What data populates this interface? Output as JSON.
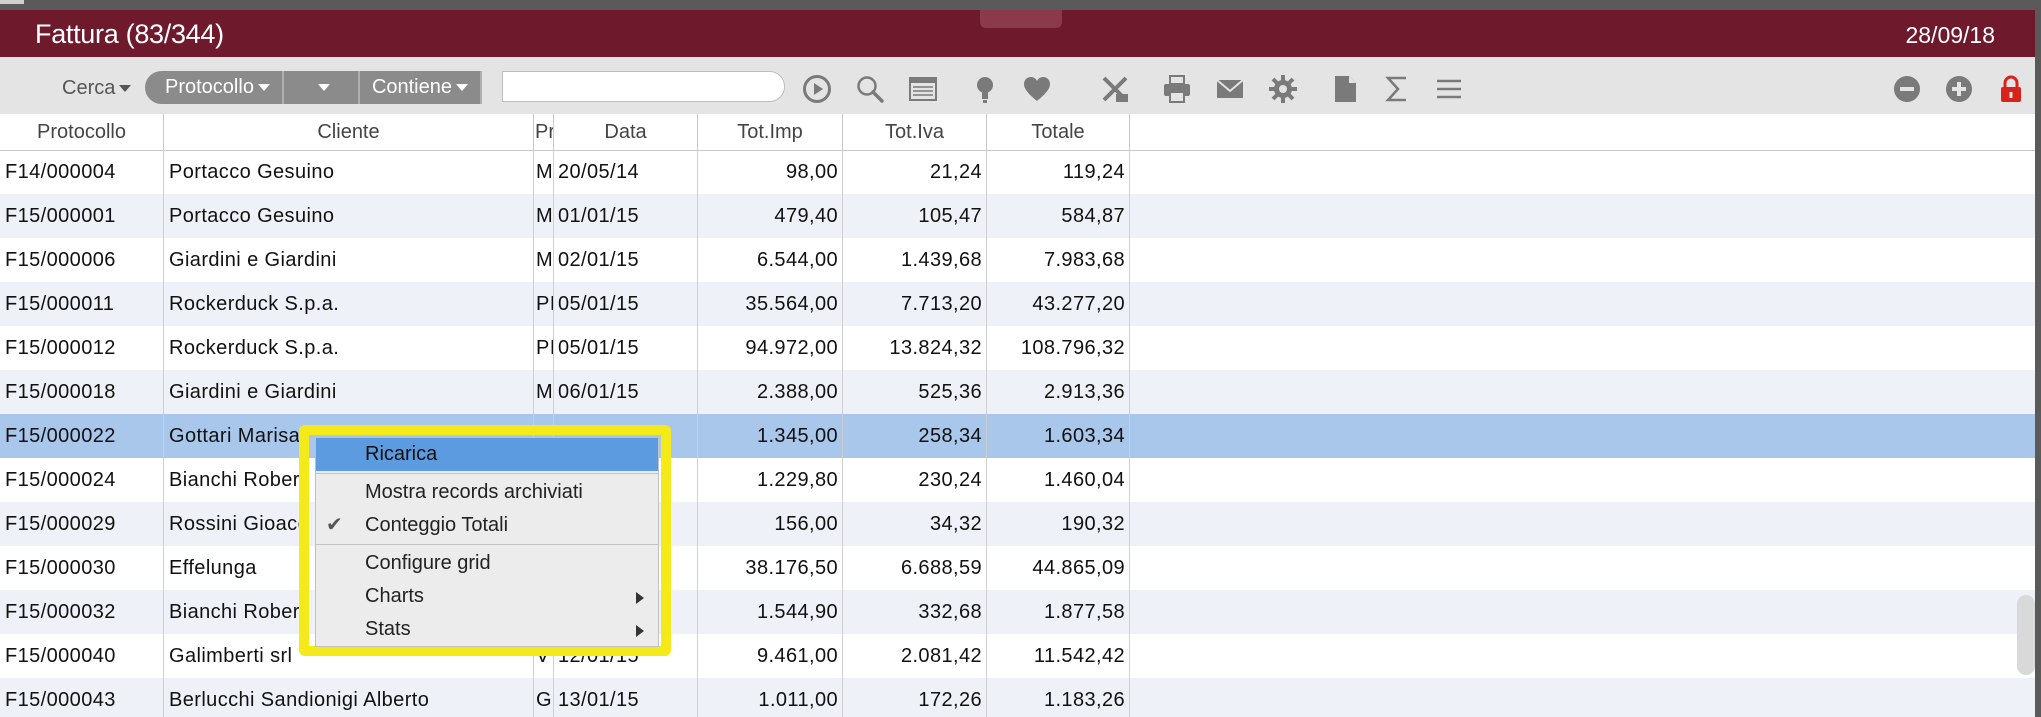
{
  "window": {
    "title": "Fattura (83/344)",
    "date": "28/09/18"
  },
  "toolbar": {
    "search_label": "Cerca",
    "field_filter": "Protocollo",
    "operator_filter": "Contiene",
    "search_placeholder": "",
    "icons": [
      "play-circle-icon",
      "search-icon",
      "list-icon",
      "bulb-icon",
      "heart-icon",
      "excel-icon",
      "print-icon",
      "mail-icon",
      "gear-icon",
      "document-icon",
      "sigma-icon",
      "menu-icon",
      "minus-circle-icon",
      "plus-circle-icon",
      "lock-icon"
    ],
    "lock_color": "#d9221c"
  },
  "grid": {
    "columns": [
      "Protocollo",
      "Cliente",
      "Pr",
      "Data",
      "Tot.Imp",
      "Tot.Iva",
      "Totale"
    ],
    "rows": [
      [
        "F14/000004",
        "Portacco Gesuino",
        "M",
        "20/05/14",
        "98,00",
        "21,24",
        "119,24"
      ],
      [
        "F15/000001",
        "Portacco Gesuino",
        "M",
        "01/01/15",
        "479,40",
        "105,47",
        "584,87"
      ],
      [
        "F15/000006",
        "Giardini e Giardini",
        "M",
        "02/01/15",
        "6.544,00",
        "1.439,68",
        "7.983,68"
      ],
      [
        "F15/000011",
        "Rockerduck S.p.a.",
        "PI",
        "05/01/15",
        "35.564,00",
        "7.713,20",
        "43.277,20"
      ],
      [
        "F15/000012",
        "Rockerduck S.p.a.",
        "PI",
        "05/01/15",
        "94.972,00",
        "13.824,32",
        "108.796,32"
      ],
      [
        "F15/000018",
        "Giardini e Giardini",
        "M",
        "06/01/15",
        "2.388,00",
        "525,36",
        "2.913,36"
      ],
      [
        "F15/000022",
        "Gottari Marisa",
        "",
        "",
        "1.345,00",
        "258,34",
        "1.603,34"
      ],
      [
        "F15/000024",
        "Bianchi Rober",
        "",
        "",
        "1.229,80",
        "230,24",
        "1.460,04"
      ],
      [
        "F15/000029",
        "Rossini Gioacc",
        "",
        "",
        "156,00",
        "34,32",
        "190,32"
      ],
      [
        "F15/000030",
        "Effelunga",
        "",
        "",
        "38.176,50",
        "6.688,59",
        "44.865,09"
      ],
      [
        "F15/000032",
        "Bianchi Rober",
        "",
        "",
        "1.544,90",
        "332,68",
        "1.877,58"
      ],
      [
        "F15/000040",
        "Galimberti srl",
        "V",
        "12/01/15",
        "9.461,00",
        "2.081,42",
        "11.542,42"
      ],
      [
        "F15/000043",
        "Berlucchi Sandionigi Alberto",
        "GI",
        "13/01/15",
        "1.011,00",
        "172,26",
        "1.183,26"
      ]
    ],
    "selected_row": 6
  },
  "context_menu": {
    "items": {
      "ricarica": "Ricarica",
      "mostra": "Mostra records archiviati",
      "conteggio": "Conteggio Totali",
      "configure": "Configure grid",
      "charts": "Charts",
      "stats": "Stats"
    },
    "conteggio_checked": true,
    "highlight_color": "#f4ea1a"
  }
}
